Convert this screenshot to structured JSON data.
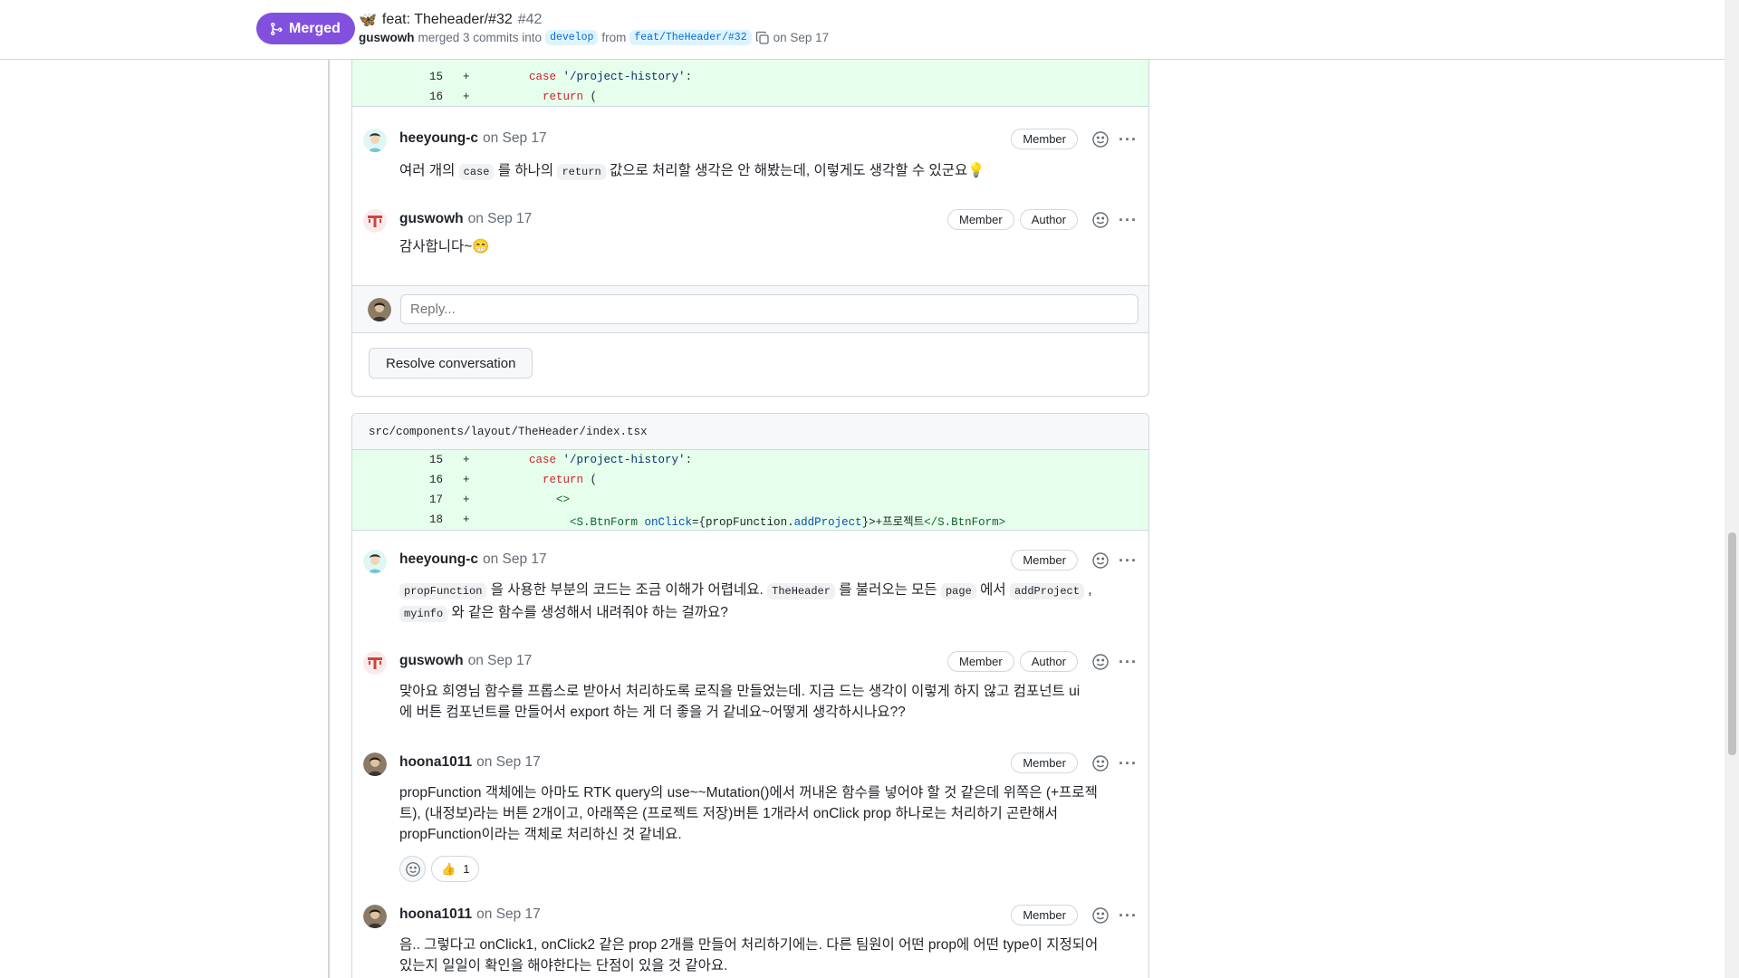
{
  "header": {
    "status": "Merged",
    "title": "feat: Theheader/#32",
    "number": "#42",
    "merger": "guswowh",
    "merged_text": "merged 3 commits into",
    "base_branch": "develop",
    "from_text": "from",
    "head_branch": "feat/TheHeader/#32",
    "date_text": "on Sep 17"
  },
  "thread1": {
    "diff": [
      {
        "ln": "15",
        "sign": "+",
        "pre": "      ",
        "kw": "case",
        "str": " '/project-history'",
        "post": ":"
      },
      {
        "ln": "16",
        "sign": "+",
        "pre": "        ",
        "kw": "return",
        "post": " ("
      }
    ],
    "comments": [
      {
        "author": "heeyoung-c",
        "date": "on Sep 17",
        "badges": [
          "Member"
        ],
        "parts": [
          "여러 개의 ",
          "case",
          " 를 하나의 ",
          "return",
          " 값으로 처리할 생각은 안 해봤는데, 이렇게도 생각할 수 있군요",
          "💡"
        ]
      },
      {
        "author": "guswowh",
        "date": "on Sep 17",
        "badges": [
          "Member",
          "Author"
        ],
        "parts": [
          "감사합니다~",
          "😁"
        ]
      }
    ],
    "reply_placeholder": "Reply...",
    "resolve_label": "Resolve conversation"
  },
  "thread2": {
    "file_path": "src/components/layout/TheHeader/index.tsx",
    "diff": [
      {
        "ln": "15",
        "sign": "+",
        "text_a": "      ",
        "kw": "case",
        "str": " '/project-history'",
        "text_b": ":"
      },
      {
        "ln": "16",
        "sign": "+",
        "text_a": "        ",
        "kw": "return",
        "text_b": " ("
      },
      {
        "ln": "17",
        "sign": "+",
        "text_a": "          ",
        "tag": "<>",
        "text_b": ""
      },
      {
        "ln": "18",
        "sign": "+",
        "text_a": "            ",
        "open": "<S.BtnForm ",
        "attr": "onClick",
        "expr1": "={propFunction.",
        "attr2": "addProject",
        "expr2": "}>",
        "txt": "+프로젝트",
        "close": "</S.BtnForm>"
      }
    ],
    "comments": [
      {
        "author": "heeyoung-c",
        "date": "on Sep 17",
        "badges": [
          "Member"
        ],
        "line1_parts": [
          "propFunction",
          " 을 사용한 부분의 코드는 조금 이해가 어렵네요. ",
          "TheHeader",
          " 를 불러오는 모든 ",
          "page",
          " 에서 ",
          "addProject",
          " ,"
        ],
        "line2_parts": [
          "myinfo",
          " 와 같은 함수를 생성해서 내려줘야 하는 걸까요?"
        ]
      },
      {
        "author": "guswowh",
        "date": "on Sep 17",
        "badges": [
          "Member",
          "Author"
        ],
        "lines": [
          "맞아요 희영님 함수를 프롭스로 받아서 처리하도록 로직을 만들었는데. 지금 드는 생각이 이렇게 하지 않고 컴포넌트 ui",
          "에 버튼 컴포넌트를 만들어서 export 하는 게 더 좋을 거 같네요~어떻게 생각하시나요??"
        ]
      },
      {
        "author": "hoona1011",
        "date": "on Sep 17",
        "badges": [
          "Member"
        ],
        "lines": [
          "propFunction 객체에는 아마도 RTK query의 use~~Mutation()에서 꺼내온 함수를 넣어야 할 것 같은데 위쪽은 (+프로젝",
          "트), (내정보)라는 버튼 2개이고, 아래쪽은 (프로젝트 저장)버튼 1개라서 onClick prop 하나로는 처리하기 곤란해서",
          "propFunction이라는 객체로 처리하신 것 같네요."
        ],
        "reaction_emoji": "👍",
        "reaction_count": "1"
      },
      {
        "author": "hoona1011",
        "date": "on Sep 17",
        "badges": [
          "Member"
        ],
        "lines": [
          "음.. 그렇다고 onClick1, onClick2 같은 prop 2개를 만들어 처리하기에는. 다른 팀원이 어떤 prop에 어떤 type이 지정되어",
          "있는지 일일이 확인을 해야한다는 단점이 있을 것 같아요."
        ]
      }
    ]
  },
  "colors": {
    "merged": "#8250df",
    "diff_add_bg": "#e6ffec",
    "border": "#d0d7de"
  },
  "icons": [
    "git-merge-icon",
    "copy-icon",
    "smiley-icon",
    "kebab-horizontal-icon",
    "thumbs-up-icon"
  ]
}
